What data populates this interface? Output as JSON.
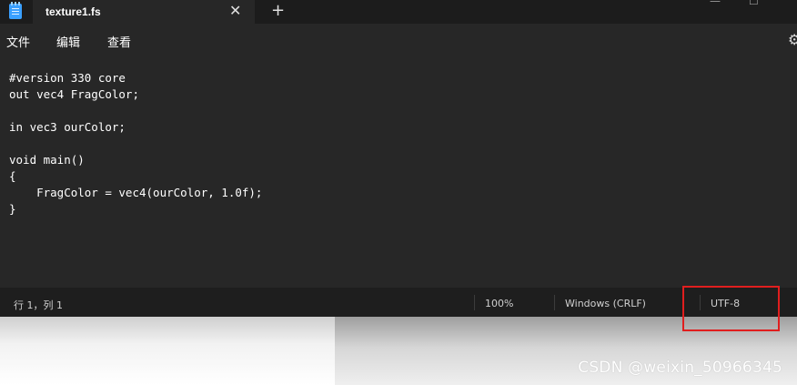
{
  "tab": {
    "title": "texture1.fs"
  },
  "menu": {
    "items": [
      "文件",
      "编辑",
      "查看"
    ]
  },
  "editor": {
    "lines": [
      "#version 330 core",
      "out vec4 FragColor;",
      "",
      "in vec3 ourColor;",
      "",
      "void main()",
      "{",
      "    FragColor = vec4(ourColor, 1.0f);",
      "}"
    ]
  },
  "status": {
    "position": "行 1，列 1",
    "zoom": "100%",
    "line_ending": "Windows (CRLF)",
    "encoding": "UTF-8"
  },
  "watermark": "CSDN @weixin_50966345",
  "colors": {
    "highlight_box": "#e01e1e"
  }
}
